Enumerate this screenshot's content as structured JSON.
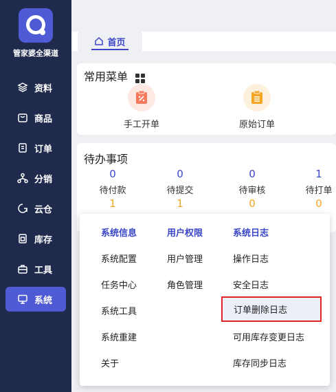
{
  "sidebar": {
    "brand": "管家婆全渠道",
    "items": [
      {
        "label": "资料",
        "icon": "layers-icon"
      },
      {
        "label": "商品",
        "icon": "product-box-icon"
      },
      {
        "label": "订单",
        "icon": "order-doc-icon"
      },
      {
        "label": "分销",
        "icon": "distribution-network-icon"
      },
      {
        "label": "云仓",
        "icon": "cloud-warehouse-icon"
      },
      {
        "label": "库存",
        "icon": "inventory-icon"
      },
      {
        "label": "工具",
        "icon": "toolbox-icon"
      },
      {
        "label": "系统",
        "icon": "monitor-icon"
      }
    ],
    "active_item": "系统"
  },
  "tabs": {
    "home": "首页"
  },
  "common_menu": {
    "title": "常用菜单",
    "tiles": [
      {
        "label": "手工开单",
        "icon": "manual-order-icon",
        "color": "#f47b5b",
        "bg": "#fde8e2"
      },
      {
        "label": "原始订单",
        "icon": "original-order-icon",
        "color": "#f5a623",
        "bg": "#fdf0dc"
      }
    ]
  },
  "todo": {
    "title": "待办事项",
    "items": [
      {
        "count": "0",
        "label": "待付款",
        "sub": "1"
      },
      {
        "count": "0",
        "label": "待提交",
        "sub": "1"
      },
      {
        "count": "0",
        "label": "待审核",
        "sub": "0"
      },
      {
        "count": "1",
        "label": "待打单",
        "sub": "0"
      }
    ]
  },
  "system_menu": {
    "columns": [
      {
        "heading": "系统信息",
        "items": [
          "系统配置",
          "任务中心",
          "系统工具",
          "系统重建",
          "关于"
        ]
      },
      {
        "heading": "用户权限",
        "items": [
          "用户管理",
          "角色管理"
        ]
      },
      {
        "heading": "系统日志",
        "items": [
          "操作日志",
          "安全日志",
          "订单删除日志",
          "可用库存变更日志",
          "库存同步日志"
        ]
      }
    ],
    "highlighted": "订单删除日志"
  },
  "colors": {
    "sidebar_bg": "#1f2a4d",
    "accent": "#4f5bd5",
    "link_blue": "#3a46c9",
    "orange": "#f5a623",
    "highlight_border": "#e02424"
  }
}
